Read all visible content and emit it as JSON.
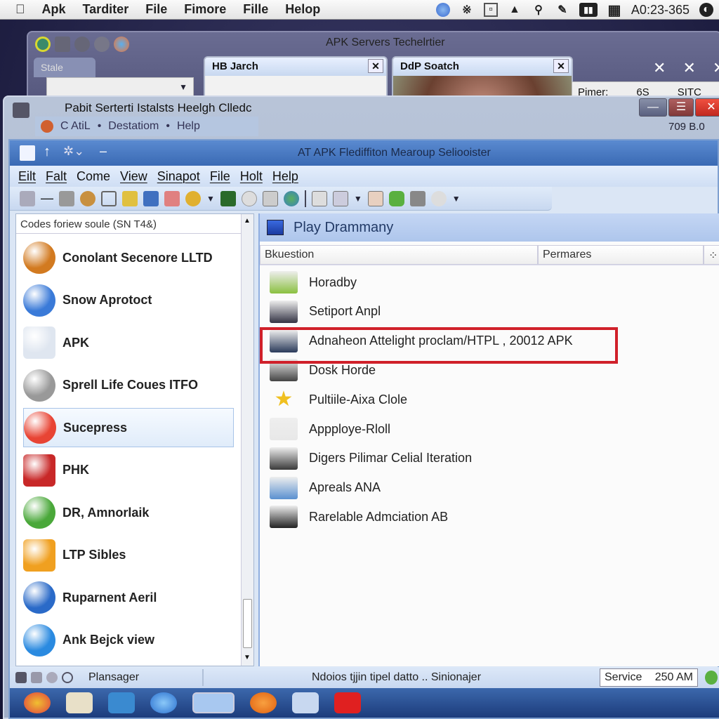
{
  "mac_menubar": {
    "apple_icon": "apple-logo-icon",
    "items": [
      "Apk",
      "Tarditer",
      "File",
      "Fimore",
      "Fille",
      "Helop"
    ],
    "status_icons": [
      "network-globe-icon",
      "bluetooth-icon",
      "screen-capture-icon",
      "airplay-icon",
      "search-icon",
      "pen-icon",
      "battery-icon",
      "grid-icon"
    ],
    "clock": "A0:23-365",
    "user_icon": "user-icon"
  },
  "back_window": {
    "title": "APK Servers Techelrtier",
    "tab_label": "Stale",
    "dialogs": [
      {
        "title": "HB Jarch"
      },
      {
        "title": "DdP Soatch"
      }
    ],
    "side_label": "Pimer:",
    "side_value": "6S",
    "side_value2": "SITC"
  },
  "main_window": {
    "title": "Pabit Serterti  Istalsts Heelgh Clledc",
    "menu": [
      "C AtiL",
      "Destatiom",
      "Help"
    ],
    "info": "709  B.0"
  },
  "inner_window": {
    "title": "AT APK Flediffiton Mearoup Seliooister",
    "menu": [
      "Eilt",
      "Falt",
      "Come",
      "View",
      "Sinapot",
      "File",
      "Holt",
      "Help"
    ],
    "left_pane": {
      "header": "Codes foriew soule (SN T4&)",
      "items": [
        {
          "label": "Conolant Secenore LLTD",
          "icon": "basketball-icon",
          "color": "#d27a20"
        },
        {
          "label": "Snow Aprotoct",
          "icon": "globe-icon",
          "color": "#3a7ad8"
        },
        {
          "label": "APK",
          "icon": "spreadsheet-icon",
          "color": "#dfe6f0"
        },
        {
          "label": "Sprell Life Coues ITFO",
          "icon": "compass-dial-icon",
          "color": "#999999"
        },
        {
          "label": "Sucepress",
          "icon": "google-icon",
          "color": "#e84434",
          "selected": true
        },
        {
          "label": "PHK",
          "icon": "red-app-icon",
          "color": "#c82828"
        },
        {
          "label": "DR, Amnorlaik",
          "icon": "green-download-arrow-icon",
          "color": "#4aa83a"
        },
        {
          "label": "LTP Sibles",
          "icon": "smiley-icon",
          "color": "#f0a020"
        },
        {
          "label": "Ruparnent Aeril",
          "icon": "z-letter-icon",
          "color": "#2a6ac8"
        },
        {
          "label": "Ank Bejck view",
          "icon": "safari-compass-icon",
          "color": "#2a8ae0"
        }
      ]
    },
    "right_pane": {
      "title": "Play Drammany",
      "columns": [
        "Bkuestion",
        "Permares"
      ],
      "items": [
        {
          "label": "Horadby",
          "icon": "folder-icon",
          "color": "#8ac040"
        },
        {
          "label": "Setiport Anpl",
          "icon": "server-tower-icon",
          "color": "#334"
        },
        {
          "label": "Adnaheon Attelight proclam/HTPL , 20012 APK",
          "icon": "monitor-icon",
          "color": "#2a3a5a",
          "highlighted": true
        },
        {
          "label": "Dosk Horde",
          "icon": "desktop-icon",
          "color": "#444"
        },
        {
          "label": "Pultiile-Aixa Clole",
          "icon": "star-icon",
          "color": "#f0c020"
        },
        {
          "label": "Appploye-Rloll",
          "icon": "clock-icon",
          "color": "#e8e8e8"
        },
        {
          "label": "Digers Pilimar Celial Iteration",
          "icon": "media-panel-icon",
          "color": "#3a3a3a"
        },
        {
          "label": "Apreals ANA",
          "icon": "image-icon",
          "color": "#5a90d0"
        },
        {
          "label": "Rarelable Admciation AB",
          "icon": "camera-lens-icon",
          "color": "#222"
        }
      ],
      "highlight_color": "#d0202a"
    },
    "status_bar": {
      "left": "Plansager",
      "center": "Ndoios tjjin tipel datto .. Sinionajer",
      "service_label": "Service",
      "time": "250 AM"
    },
    "taskbar": [
      "photos-icon",
      "notes-icon",
      "app-store-icon",
      "safari-icon",
      "monitor-icon",
      "orange-app-icon",
      "dashboard-icon",
      "youtube-icon"
    ]
  }
}
